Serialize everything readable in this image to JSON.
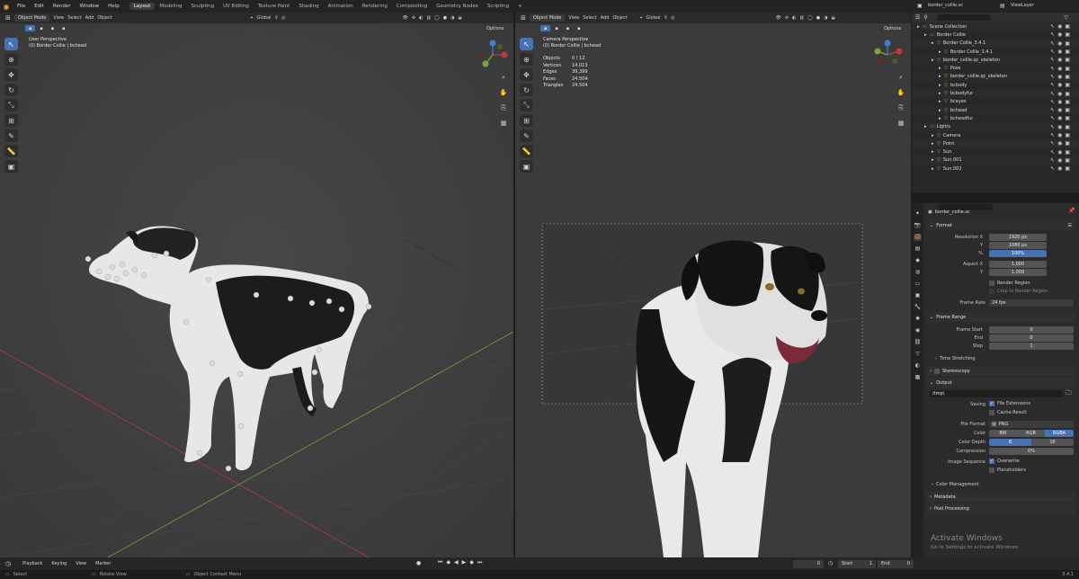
{
  "top_menu": [
    "File",
    "Edit",
    "Render",
    "Window",
    "Help"
  ],
  "workspaces": [
    "Layout",
    "Modeling",
    "Sculpting",
    "UV Editing",
    "Texture Paint",
    "Shading",
    "Animation",
    "Rendering",
    "Compositing",
    "Geometry Nodes",
    "Scripting",
    "+"
  ],
  "active_workspace": "Layout",
  "scene_name": "border_collie.sc",
  "view_layer": "ViewLayer",
  "viewport_left": {
    "mode": "Object Mode",
    "menus": [
      "View",
      "Select",
      "Add",
      "Object"
    ],
    "transform": "Global",
    "options": "Options",
    "title": "User Perspective",
    "subtitle": "(0) Border Collie | bchead"
  },
  "viewport_right": {
    "mode": "Object Mode",
    "menus": [
      "View",
      "Select",
      "Add",
      "Object"
    ],
    "transform": "Global",
    "options": "Options",
    "title": "Camera Perspective",
    "subtitle": "(0) Border Collie | bchead",
    "stats": [
      {
        "label": "Objects",
        "value": "0 / 12"
      },
      {
        "label": "Vertices",
        "value": "14,013"
      },
      {
        "label": "Edges",
        "value": "39,399"
      },
      {
        "label": "Faces",
        "value": "24,504"
      },
      {
        "label": "Triangles",
        "value": "24,504"
      }
    ]
  },
  "outliner": {
    "rows": [
      {
        "label": "Scene Collection",
        "indent": 0,
        "color": "#dddddd"
      },
      {
        "label": "Border Collie",
        "indent": 1,
        "color": "#dddddd"
      },
      {
        "label": "Border Collie_3.4.1",
        "indent": 2,
        "color": "#dddddd"
      },
      {
        "label": "Border Collie_3.4.1",
        "indent": 3,
        "color": "#dddddd"
      },
      {
        "label": "border_collie.qc_skeleton",
        "indent": 2,
        "color": "#dddddd"
      },
      {
        "label": "Pose",
        "indent": 3,
        "color": "#dddddd"
      },
      {
        "label": "border_collie.qc_skeleton",
        "indent": 3,
        "color": "#dddddd"
      },
      {
        "label": "bcbody",
        "indent": 3,
        "color": "#dddddd"
      },
      {
        "label": "bcbodyfur",
        "indent": 3,
        "color": "#dddddd"
      },
      {
        "label": "bceyes",
        "indent": 3,
        "color": "#dddddd"
      },
      {
        "label": "bchead",
        "indent": 3,
        "color": "#dddddd"
      },
      {
        "label": "bcheadfur",
        "indent": 3,
        "color": "#dddddd"
      },
      {
        "label": "Lights",
        "indent": 1,
        "color": "#dddddd"
      },
      {
        "label": "Camera",
        "indent": 2,
        "color": "#dddddd"
      },
      {
        "label": "Point",
        "indent": 2,
        "color": "#dddddd"
      },
      {
        "label": "Sun",
        "indent": 2,
        "color": "#dddddd"
      },
      {
        "label": "Sun.001",
        "indent": 2,
        "color": "#dddddd"
      },
      {
        "label": "Sun.002",
        "indent": 2,
        "color": "#dddddd"
      }
    ]
  },
  "properties": {
    "title": "border_collie.sc",
    "format": {
      "header": "Format",
      "resolution_x_label": "Resolution X",
      "resolution_x": "1920 px",
      "y_label": "Y",
      "resolution_y": "1080 px",
      "pct_label": "%",
      "pct": "100%",
      "aspect_x_label": "Aspect X",
      "aspect_x": "1.000",
      "aspect_y": "1.000",
      "render_region": "Render Region",
      "crop_region": "Crop to Render Region",
      "frame_rate_label": "Frame Rate",
      "frame_rate": "24 fps"
    },
    "frame_range": {
      "header": "Frame Range",
      "start_label": "Frame Start",
      "start": "0",
      "end_label": "End",
      "end": "0",
      "step_label": "Step",
      "step": "1",
      "time_stretching": "Time Stretching",
      "stereoscopy": "Stereoscopy"
    },
    "output": {
      "header": "Output",
      "path": "/tmp\\",
      "saving_label": "Saving",
      "file_extensions": "File Extensions",
      "cache_result": "Cache Result",
      "file_format_label": "File Format",
      "file_format": "PNG",
      "color_label": "Color",
      "color_options": [
        "BW",
        "RGB",
        "RGBA"
      ],
      "color_selected": "RGBA",
      "color_depth_label": "Color Depth",
      "color_depth_options": [
        "8",
        "16"
      ],
      "color_depth_selected": "8",
      "compression_label": "Compression",
      "compression": "0%",
      "image_sequence_label": "Image Sequence",
      "overwrite": "Overwrite",
      "placeholders": "Placeholders",
      "color_management": "Color Management"
    },
    "metadata": "Metadata",
    "post_processing": "Post Processing"
  },
  "watermark": {
    "line1": "Activate Windows",
    "line2": "Go to Settings to activate Windows."
  },
  "timeline": {
    "menus": [
      "Playback",
      "Keying",
      "View",
      "Marker"
    ],
    "current_frame": "0",
    "start_label": "Start",
    "start": "1",
    "end_label": "End",
    "end": "0"
  },
  "status": {
    "items": [
      "Select",
      "Rotate View",
      "Object Context Menu"
    ],
    "version": "3.4.1"
  },
  "colors": {
    "accent": "#4772b3",
    "x_axis": "#c0393b",
    "y_axis": "#7fa33a",
    "z_axis": "#3f7fd0"
  }
}
